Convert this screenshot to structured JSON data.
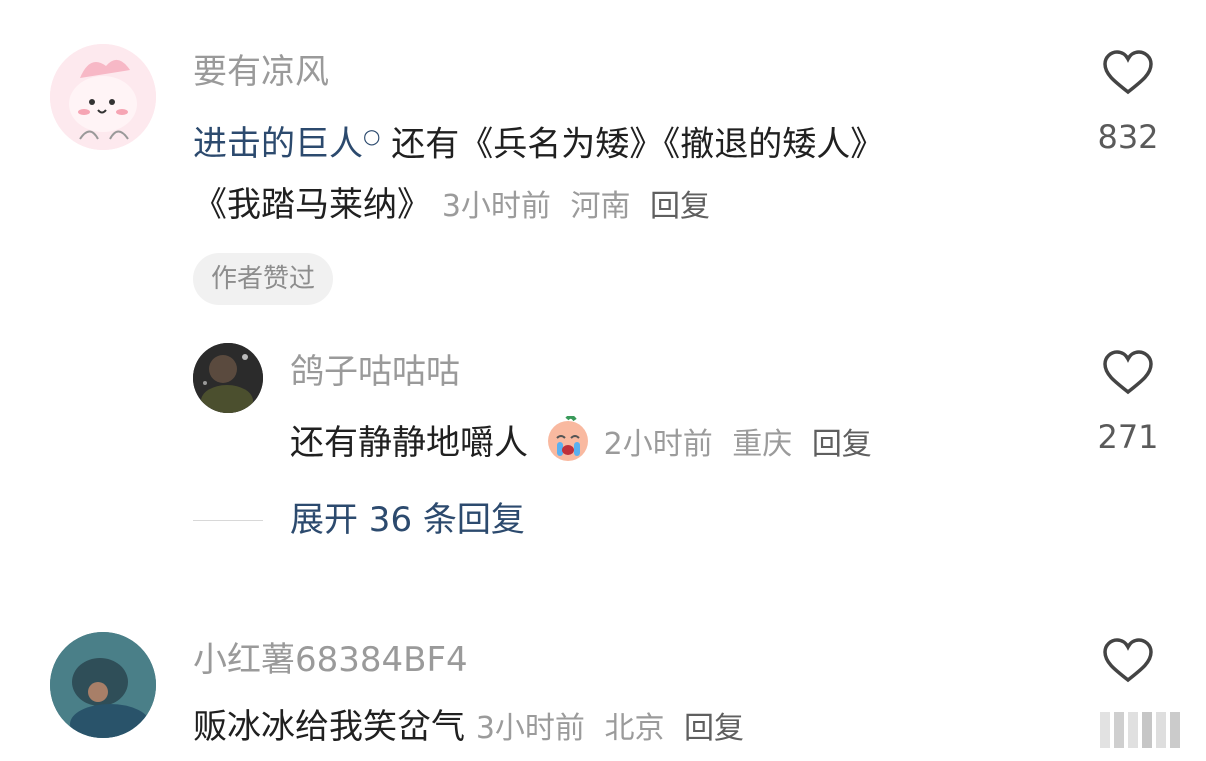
{
  "comments": [
    {
      "username": "要有凉风",
      "link_text": "进击的巨人",
      "text_line1": " 还有《兵名为矮》《撤退的矮人》",
      "text_line2": "《我踏马莱纳》",
      "time": "3小时前",
      "location": "河南",
      "reply_label": "回复",
      "badge": "作者赞过",
      "likes": "832"
    },
    {
      "username": "小红薯68384BF4",
      "text": "贩冰冰给我笑岔气",
      "time": "3小时前",
      "location": "北京",
      "reply_label": "回复"
    }
  ],
  "replies": [
    {
      "username": "鸽子咕咕咕",
      "text": "还有静静地嚼人",
      "time": "2小时前",
      "location": "重庆",
      "reply_label": "回复",
      "likes": "271"
    }
  ],
  "expand_label": "展开 36 条回复",
  "colors": {
    "link": "#2c4a6e",
    "muted": "#9a9a9a",
    "badge_bg": "#f1f1f1"
  }
}
